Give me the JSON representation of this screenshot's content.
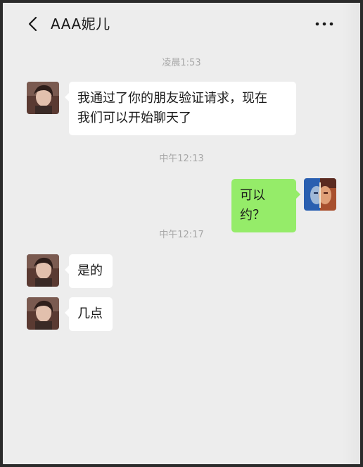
{
  "header": {
    "contact_name": "AAA妮儿",
    "back_icon": "chevron-left-icon",
    "more_icon": "more-dots-icon"
  },
  "messages": [
    {
      "type": "time",
      "text": "凌晨1:53"
    },
    {
      "type": "received",
      "sender": "contact",
      "lines": [
        "我通过了你的朋友验证请求，现在",
        "我们可以开始聊天了"
      ]
    },
    {
      "type": "time",
      "text": "中午12:13"
    },
    {
      "type": "sent",
      "sender": "me",
      "text": "可以约？"
    },
    {
      "type": "time",
      "text": "中午12:17"
    },
    {
      "type": "received",
      "sender": "contact",
      "text": "是的"
    },
    {
      "type": "received",
      "sender": "contact",
      "text": "几点"
    }
  ],
  "colors": {
    "background": "#ededed",
    "received_bubble": "#ffffff",
    "sent_bubble": "#95ec69",
    "timestamp": "#a8a8a8"
  }
}
